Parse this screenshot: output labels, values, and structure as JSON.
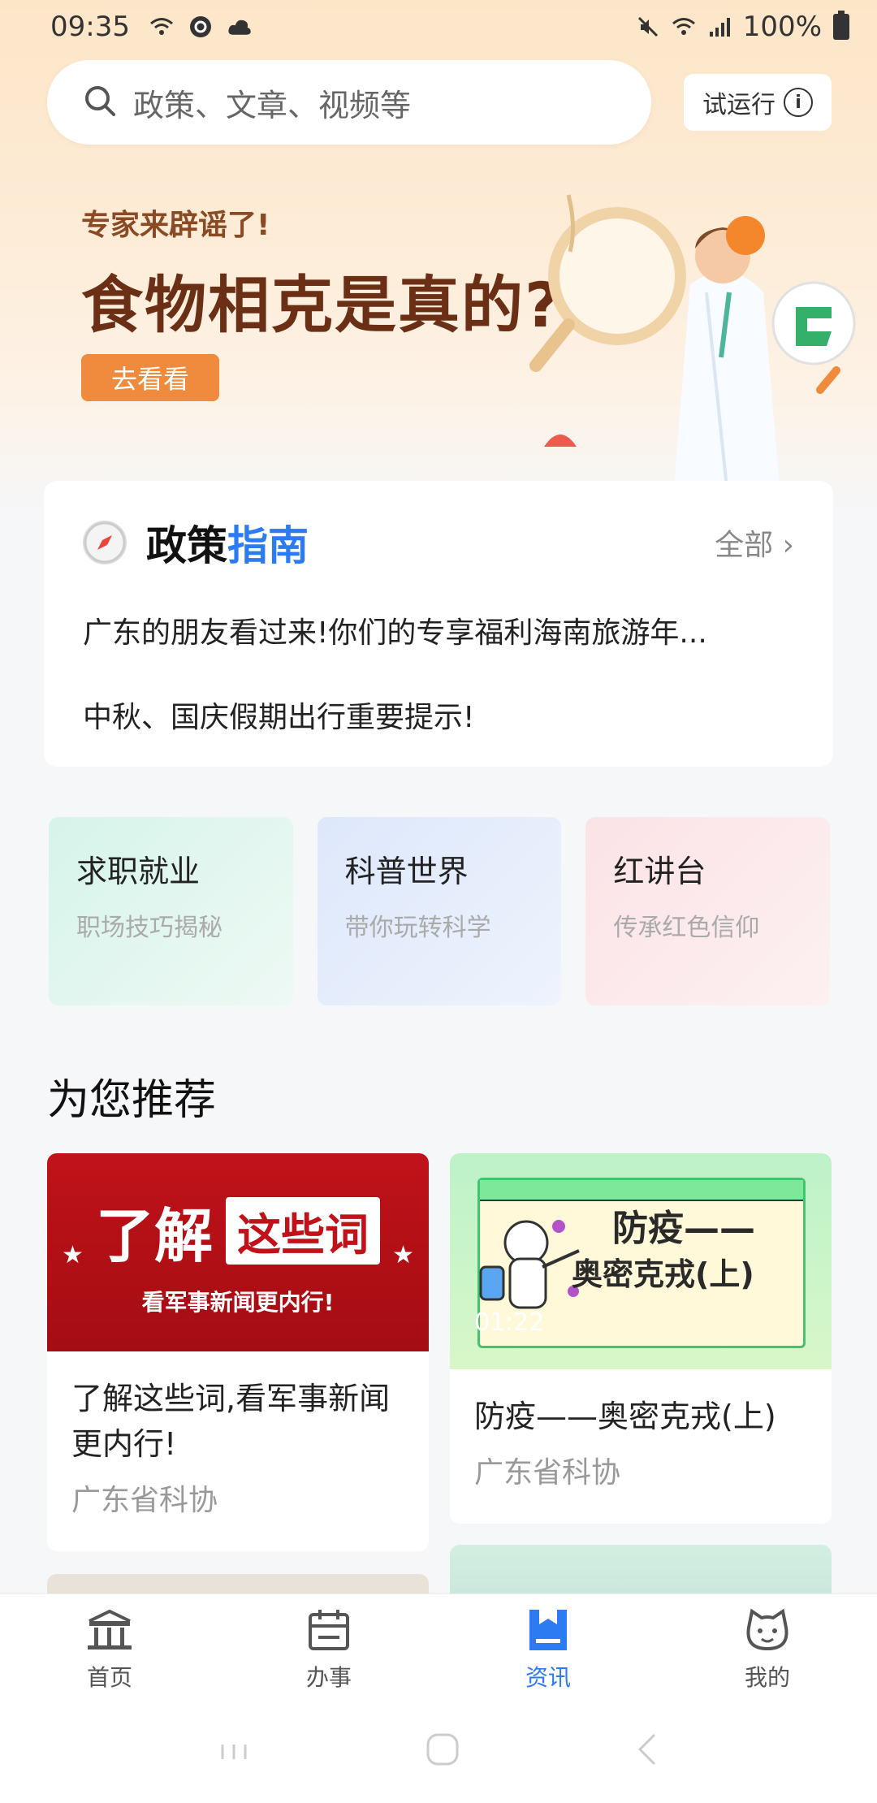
{
  "status_bar": {
    "time": "09:35",
    "battery": "100%"
  },
  "search": {
    "placeholder": "政策、文章、视频等",
    "trial_label": "试运行"
  },
  "banner": {
    "subtitle": "专家来辟谣了!",
    "title": "食物相克是真的?",
    "button": "去看看"
  },
  "policy": {
    "title_black": "政策",
    "title_blue": "指南",
    "all_label": "全部",
    "items": [
      "广东的朋友看过来!你们的专享福利海南旅游年...",
      "中秋、国庆假期出行重要提示!"
    ]
  },
  "categories": [
    {
      "title": "求职就业",
      "subtitle": "职场技巧揭秘"
    },
    {
      "title": "科普世界",
      "subtitle": "带你玩转科学"
    },
    {
      "title": "红讲台",
      "subtitle": "传承红色信仰"
    }
  ],
  "recommend": {
    "title": "为您推荐",
    "cards": [
      {
        "thumb_big": "了解",
        "thumb_box": "这些词",
        "thumb_sub": "看军事新闻更内行!",
        "title": "了解这些词,看军事新闻更内行!",
        "source": "广东省科协"
      },
      {
        "thumb_line1": "防疫——",
        "thumb_line2": "奥密克戎(上)",
        "duration": "01:22",
        "title": "防疫——奥密克戎(上)",
        "source": "广东省科协"
      }
    ]
  },
  "tabbar": {
    "items": [
      {
        "label": "首页",
        "icon": "home-icon"
      },
      {
        "label": "办事",
        "icon": "calendar-icon"
      },
      {
        "label": "资讯",
        "icon": "news-icon"
      },
      {
        "label": "我的",
        "icon": "profile-icon"
      }
    ],
    "active_color": "#2c7bf2"
  }
}
